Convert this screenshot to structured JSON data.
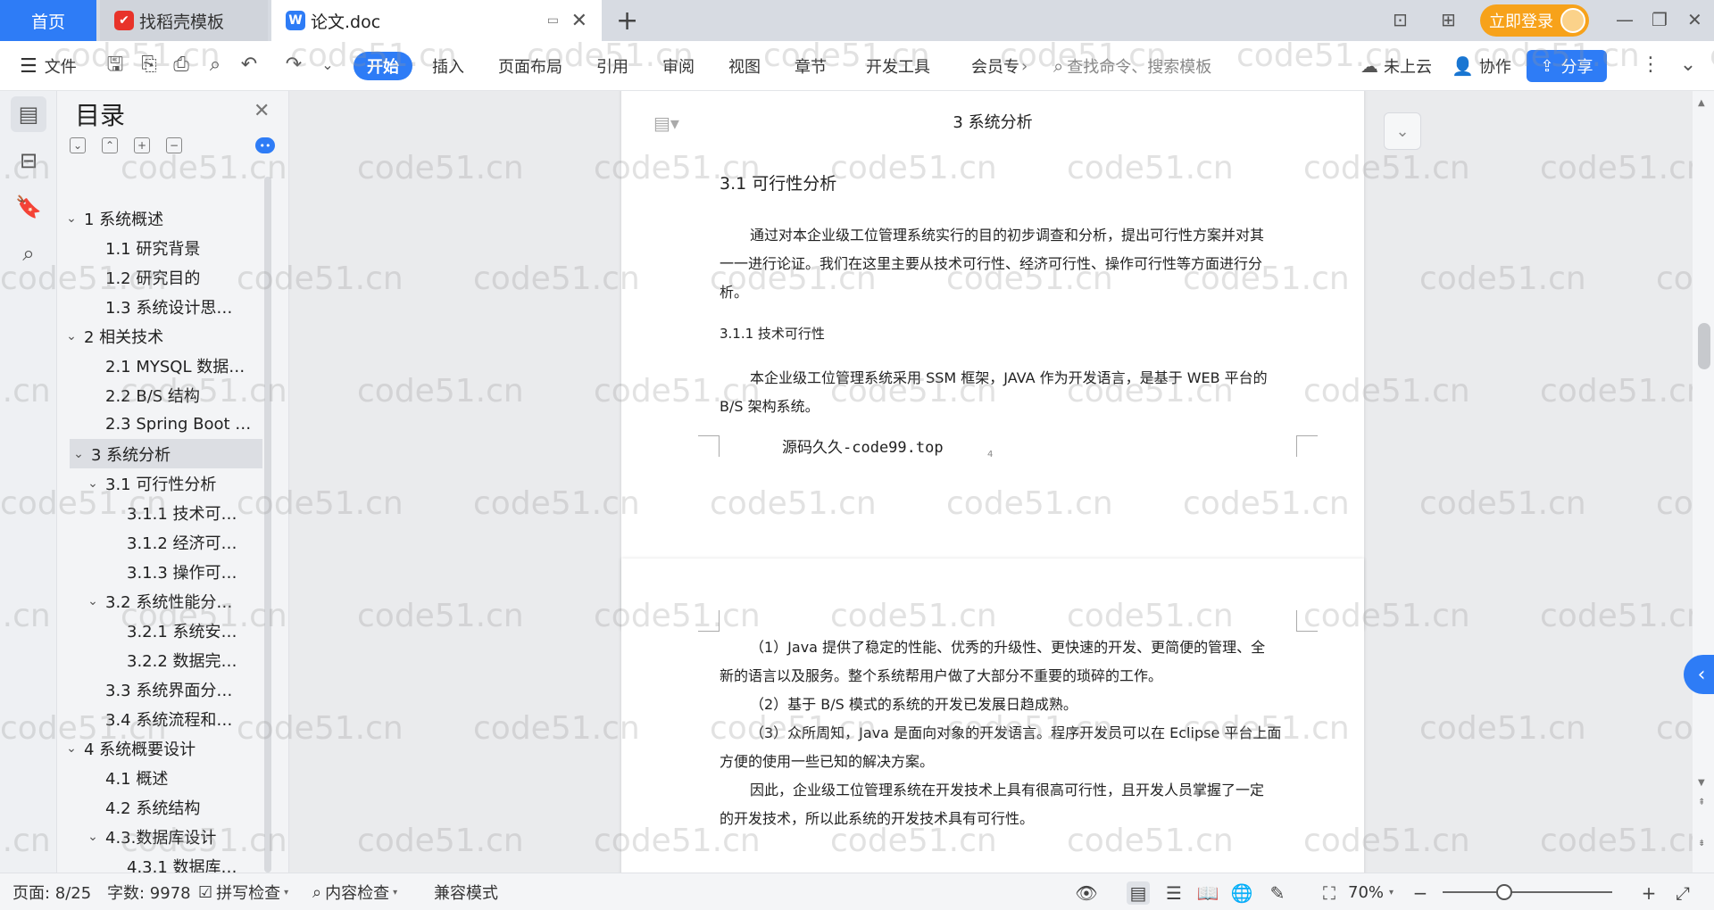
{
  "tabs": {
    "home": "首页",
    "template": "找稻壳模板",
    "document": "论文.doc",
    "add_tab": "+"
  },
  "account": {
    "login": "立即登录"
  },
  "ribbon": {
    "file": "文件",
    "start": "开始",
    "insert": "插入",
    "page_layout": "页面布局",
    "references": "引用",
    "review": "审阅",
    "view": "视图",
    "chapter": "章节",
    "dev_tools": "开发工具",
    "member": "会员专",
    "search_placeholder": "查找命令、搜索模板",
    "cloud": "未上云",
    "collaborate": "协作",
    "share": "分享"
  },
  "outline": {
    "title": "目录",
    "items": [
      {
        "label": "1 系统概述",
        "level": 1,
        "caret": "v"
      },
      {
        "label": "1.1  研究背景",
        "level": 2,
        "caret": ""
      },
      {
        "label": "1.2 研究目的",
        "level": 2,
        "caret": ""
      },
      {
        "label": "1.3 系统设计思…",
        "level": 2,
        "caret": ""
      },
      {
        "label": "2 相关技术",
        "level": 1,
        "caret": "v"
      },
      {
        "label": "2.1 MYSQL 数据…",
        "level": 2,
        "caret": ""
      },
      {
        "label": "2.2 B/S 结构",
        "level": 2,
        "caret": ""
      },
      {
        "label": "2.3 Spring Boot …",
        "level": 2,
        "caret": ""
      },
      {
        "label": "3 系统分析",
        "level": 1,
        "caret": "v",
        "selected": true
      },
      {
        "label": "3.1 可行性分析",
        "level": 2,
        "caret": "v"
      },
      {
        "label": "3.1.1 技术可…",
        "level": 3,
        "caret": ""
      },
      {
        "label": "3.1.2 经济可…",
        "level": 3,
        "caret": ""
      },
      {
        "label": "3.1.3 操作可…",
        "level": 3,
        "caret": ""
      },
      {
        "label": "3.2 系统性能分…",
        "level": 2,
        "caret": "v"
      },
      {
        "label": "3.2.1  系统安…",
        "level": 3,
        "caret": ""
      },
      {
        "label": "3.2.2  数据完…",
        "level": 3,
        "caret": ""
      },
      {
        "label": "3.3 系统界面分…",
        "level": 2,
        "caret": ""
      },
      {
        "label": "3.4 系统流程和…",
        "level": 2,
        "caret": ""
      },
      {
        "label": "4 系统概要设计",
        "level": 1,
        "caret": "v"
      },
      {
        "label": "4.1 概述",
        "level": 2,
        "caret": ""
      },
      {
        "label": "4.2 系统结构",
        "level": 2,
        "caret": ""
      },
      {
        "label": "4.3.数据库设计",
        "level": 2,
        "caret": "v"
      },
      {
        "label": "4.3.1 数据库…",
        "level": 3,
        "caret": ""
      }
    ]
  },
  "document": {
    "page1": {
      "header": "3 系统分析",
      "h2": "3.1 可行性分析",
      "para1_l1": "通过对本企业级工位管理系统实行的目的初步调查和分析，提出可行性方案并对其",
      "para1_l2": "一一进行论证。我们在这里主要从技术可行性、经济可行性、操作可行性等方面进行分",
      "para1_l3": "析。",
      "h3": "3.1.1 技术可行性",
      "para2_l1": "本企业级工位管理系统采用 SSM 框架，JAVA 作为开发语言，是基于 WEB 平台的",
      "para2_l2": "B/S 架构系统。",
      "footer_text": "源码久久-code99.top",
      "page_number": "4"
    },
    "page2": {
      "l1": "（1）Java 提供了稳定的性能、优秀的升级性、更快速的开发、更简便的管理、全",
      "l2": "新的语言以及服务。整个系统帮用户做了大部分不重要的琐碎的工作。",
      "l3": "（2）基于 B/S 模式的系统的开发已发展日趋成熟。",
      "l4": "（3）众所周知，Java 是面向对象的开发语言。程序开发员可以在 Eclipse 平台上面",
      "l5": "方便的使用一些已知的解决方案。",
      "l6": "因此，企业级工位管理系统在开发技术上具有很高可行性，且开发人员掌握了一定",
      "l7": "的开发技术，所以此系统的开发技术具有可行性。"
    }
  },
  "watermark": "code51.cn",
  "statusbar": {
    "page": "页面: 8/25",
    "words": "字数: 9978",
    "spellcheck": "拼写检查",
    "content_check": "内容检查",
    "compat": "兼容模式",
    "zoom": "70%"
  },
  "colors": {
    "accent": "#2e7cf6",
    "login": "#f7a21a"
  }
}
